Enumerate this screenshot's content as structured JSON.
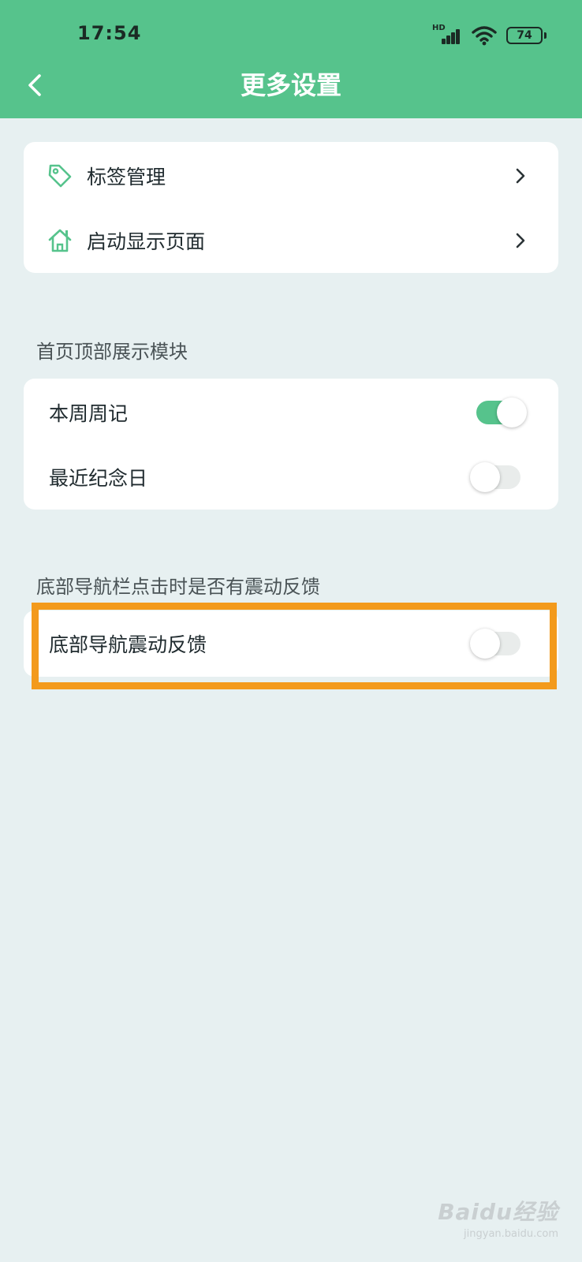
{
  "status_bar": {
    "time": "17:54",
    "network": "HD",
    "battery": "74"
  },
  "header": {
    "title": "更多设置",
    "back_icon": "chevron-left-icon"
  },
  "general_card": {
    "items": [
      {
        "label": "标签管理",
        "icon": "tag-icon"
      },
      {
        "label": "启动显示页面",
        "icon": "home-icon"
      }
    ]
  },
  "home_modules": {
    "section_title": "首页顶部展示模块",
    "items": [
      {
        "label": "本周周记",
        "enabled": true
      },
      {
        "label": "最近纪念日",
        "enabled": false
      }
    ]
  },
  "nav_feedback": {
    "section_title": "底部导航栏点击时是否有震动反馈",
    "items": [
      {
        "label": "底部导航震动反馈",
        "enabled": false
      }
    ]
  },
  "watermark": {
    "brand": "Baidu经验",
    "url": "jingyan.baidu.com"
  },
  "colors": {
    "accent": "#56c38c",
    "background": "#e7f0f1",
    "highlight": "#f39a1c"
  }
}
